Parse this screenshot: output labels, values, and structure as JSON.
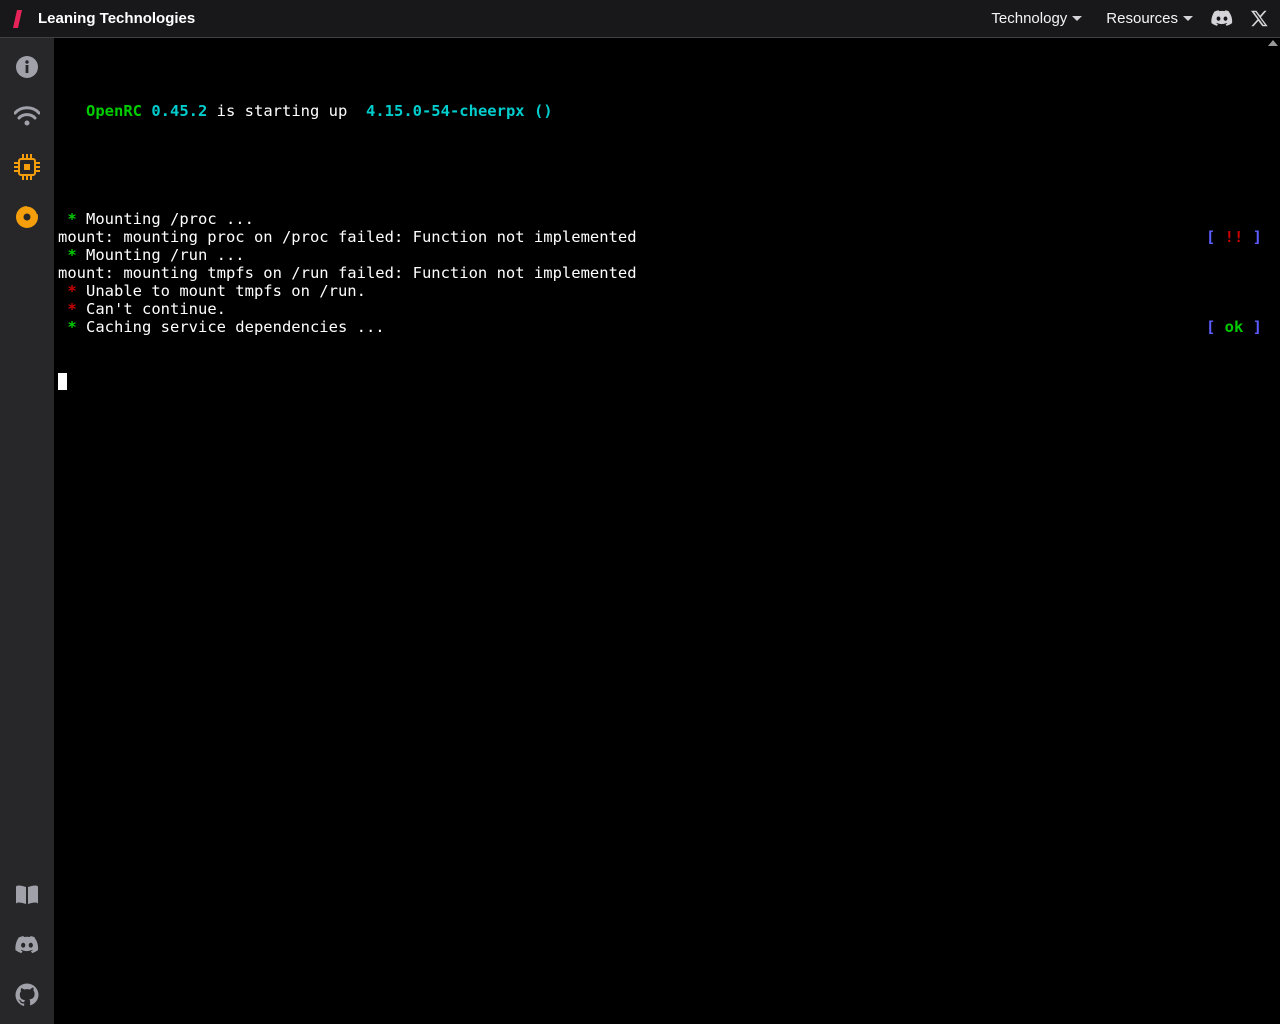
{
  "header": {
    "brand": "Leaning Technologies",
    "nav": [
      {
        "label": "Technology"
      },
      {
        "label": "Resources"
      }
    ]
  },
  "terminal": {
    "boot": {
      "openrc": "OpenRC",
      "version": "0.45.2",
      "starting": " is starting up ",
      "kernel": " 4.15.0-54-cheerpx ()"
    },
    "lines": [
      {
        "star": "green",
        "text": "Mounting /proc ...",
        "status": null
      },
      {
        "star": null,
        "text": "mount: mounting proc on /proc failed: Function not implemented",
        "status": "fail"
      },
      {
        "star": "green",
        "text": "Mounting /run ...",
        "status": null
      },
      {
        "star": null,
        "text": "mount: mounting tmpfs on /run failed: Function not implemented",
        "status": null
      },
      {
        "star": "red",
        "text": "Unable to mount tmpfs on /run.",
        "status": null
      },
      {
        "star": "red",
        "text": "Can't continue.",
        "status": null
      },
      {
        "star": "green",
        "text": "Caching service dependencies ...",
        "status": "ok"
      }
    ],
    "status_labels": {
      "ok": "ok",
      "fail": "!!",
      "bracket_open": "[ ",
      "bracket_close": " ]"
    }
  }
}
